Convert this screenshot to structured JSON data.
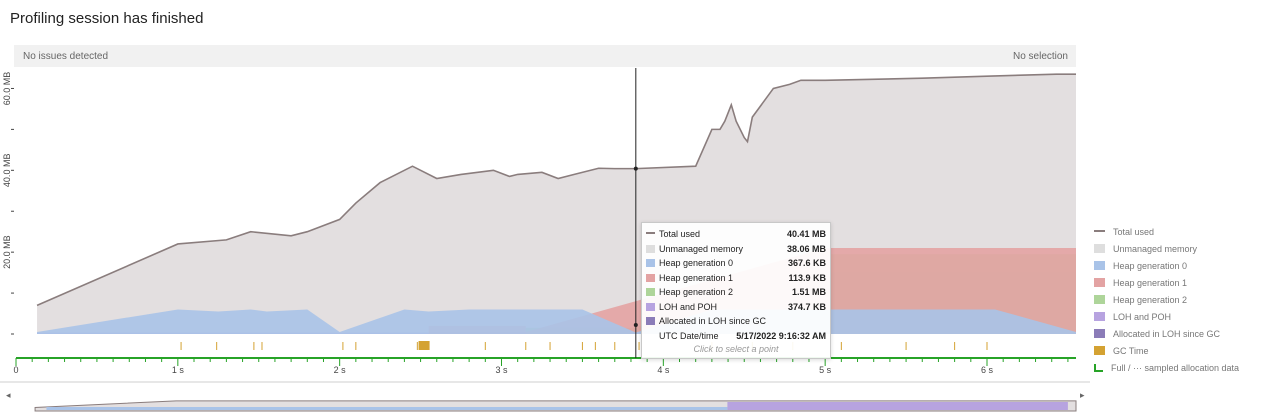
{
  "title": "Profiling session has finished",
  "status": {
    "left": "No issues detected",
    "right": "No selection"
  },
  "y_axis": [
    "60.0 MB",
    "40.0 MB",
    "20.0 MB"
  ],
  "x_axis": [
    "0",
    "1 s",
    "2 s",
    "3 s",
    "4 s",
    "5 s",
    "6 s"
  ],
  "legend": [
    {
      "label": "Total used",
      "color": "#8a7d7d",
      "kind": "line"
    },
    {
      "label": "Unmanaged memory",
      "color": "#dedede",
      "kind": "box"
    },
    {
      "label": "Heap generation 0",
      "color": "#a9c3e8",
      "kind": "box"
    },
    {
      "label": "Heap generation 1",
      "color": "#e3a3a3",
      "kind": "box"
    },
    {
      "label": "Heap generation 2",
      "color": "#aed59a",
      "kind": "box"
    },
    {
      "label": "LOH and POH",
      "color": "#b7a3e0",
      "kind": "box"
    },
    {
      "label": "Allocated in LOH since GC",
      "color": "#8b7cb8",
      "kind": "box"
    },
    {
      "label": "GC Time",
      "color": "#d4a232",
      "kind": "box"
    },
    {
      "label": "Full / ··· sampled allocation data",
      "color": "#27a327",
      "kind": "step"
    }
  ],
  "tooltip": {
    "rows": [
      {
        "label": "Total used",
        "value": "40.41 MB",
        "color": "#8a7d7d"
      },
      {
        "label": "Unmanaged memory",
        "value": "38.06 MB",
        "color": "#dedede"
      },
      {
        "label": "Heap generation 0",
        "value": "367.6 KB",
        "color": "#a9c3e8"
      },
      {
        "label": "Heap generation 1",
        "value": "113.9 KB",
        "color": "#e3a3a3"
      },
      {
        "label": "Heap generation 2",
        "value": "1.51 MB",
        "color": "#aed59a"
      },
      {
        "label": "LOH and POH",
        "value": "374.7 KB",
        "color": "#b7a3e0"
      },
      {
        "label": "Allocated in LOH since GC",
        "value": "",
        "color": "#8b7cb8"
      },
      {
        "label": "UTC Date/time",
        "value": "5/17/2022 9:16:32 AM",
        "color": ""
      }
    ],
    "hint": "Click to select a point"
  },
  "chart_data": {
    "type": "area",
    "xlabel": "",
    "ylabel": "",
    "x_unit": "s",
    "y_unit": "MB",
    "xlim": [
      0,
      6.55
    ],
    "ylim": [
      0,
      65
    ],
    "cursor_x": 3.83,
    "series": [
      {
        "name": "Total used",
        "x": [
          0.13,
          1.0,
          1.3,
          1.45,
          1.7,
          1.8,
          2.0,
          2.1,
          2.25,
          2.45,
          2.5,
          2.6,
          2.75,
          2.95,
          3.05,
          3.1,
          3.25,
          3.35,
          3.45,
          3.6,
          3.7,
          3.83,
          4.2,
          4.3,
          4.35,
          4.38,
          4.42,
          4.45,
          4.5,
          4.52,
          4.55,
          4.68,
          4.78,
          4.85,
          5.0,
          5.6,
          6.0,
          6.43,
          6.55
        ],
        "y": [
          7,
          22,
          23,
          25,
          24,
          25,
          28,
          32,
          37,
          41,
          40,
          38,
          39,
          40,
          38.5,
          39,
          39.5,
          38,
          39,
          40.5,
          40.41,
          40.41,
          41,
          50,
          50,
          52,
          56,
          52,
          48,
          47,
          53,
          60,
          61,
          62,
          62,
          62.5,
          63,
          63.5,
          63.5
        ]
      },
      {
        "name": "Heap generation 0",
        "values_note": "",
        "x": [
          0.13,
          1.0,
          1.25,
          1.45,
          1.55,
          1.8,
          2.0,
          2.4,
          2.55,
          2.8,
          3.0,
          3.2,
          3.5,
          3.83,
          4.3,
          4.6,
          4.75,
          5.0,
          5.4,
          5.8,
          6.05,
          6.55
        ],
        "y": [
          0.5,
          6,
          5.5,
          6,
          5.5,
          6,
          0.5,
          6,
          5.5,
          6,
          6,
          6,
          6,
          0.37,
          6,
          6,
          6,
          6,
          6,
          6,
          6,
          0.5
        ]
      },
      {
        "name": "Heap generation 1",
        "x": [
          2.55,
          3.15,
          3.15,
          5.0,
          6.55
        ],
        "y": [
          2,
          2,
          0.5,
          21,
          21
        ]
      },
      {
        "name": "Heap generation 2",
        "x": [
          3.15,
          3.83,
          4.6,
          5.0,
          6.55
        ],
        "y": [
          1.5,
          1.51,
          15,
          19.5,
          19.5
        ]
      },
      {
        "name": "LOH and POH",
        "x": [
          0.13,
          3.83,
          4.6,
          5.0,
          6.55
        ],
        "y": [
          0.3,
          0.37,
          12,
          15,
          15
        ]
      }
    ],
    "gc_time_x": [
      1.02,
      1.24,
      1.47,
      1.52,
      2.02,
      2.1,
      2.48,
      2.5,
      2.9,
      3.15,
      3.3,
      3.5,
      3.58,
      3.7,
      3.85,
      4.3,
      4.55,
      4.8,
      5.1,
      5.5,
      5.8,
      6.0
    ],
    "gc_big": {
      "x": 2.5,
      "label": "GC Time"
    }
  }
}
